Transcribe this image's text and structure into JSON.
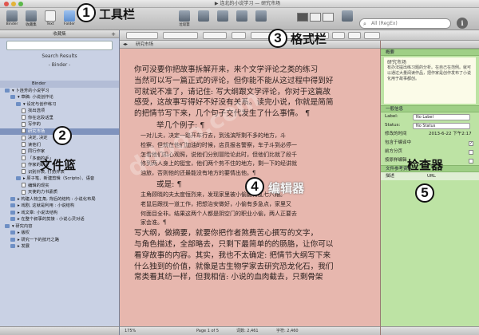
{
  "window": {
    "title": "▶ 连北的小说学习 — 研究市场"
  },
  "toolbar": {
    "buttons": [
      {
        "id": "binder",
        "label": "Binder"
      },
      {
        "id": "collection",
        "label": "收藏集"
      },
      {
        "id": "text",
        "label": "Text"
      },
      {
        "id": "folder",
        "label": "Folder"
      },
      {
        "id": "trash",
        "label": "垃圾篓"
      }
    ],
    "search_placeholder": "All (RegEx)"
  },
  "binder": {
    "header": "收藏集",
    "search_results": "Search Results",
    "binder_label": "- Binder -",
    "tree": [
      {
        "label": "Binder",
        "kind": "head"
      },
      {
        "label": "▾ 卜连芳的小说学习",
        "kind": "folder",
        "indent": 0
      },
      {
        "label": "▾ 草稿: 小说创作论",
        "kind": "folder",
        "indent": 1
      },
      {
        "label": "▾ 设定与创作练习",
        "kind": "folder",
        "indent": 2
      },
      {
        "label": "找出选项",
        "kind": "doc",
        "indent": 3
      },
      {
        "label": "你在这段话里",
        "kind": "doc",
        "indent": 3
      },
      {
        "label": "写作的",
        "kind": "doc",
        "indent": 3
      },
      {
        "label": "研究市场",
        "kind": "doc",
        "indent": 3,
        "selected": true
      },
      {
        "label": "决定, 决定",
        "kind": "doc",
        "indent": 3
      },
      {
        "label": "读他们",
        "kind": "doc",
        "indent": 3
      },
      {
        "label": "同行作家",
        "kind": "doc",
        "indent": 3
      },
      {
        "label": "「多面的手」",
        "kind": "doc",
        "indent": 3
      },
      {
        "label": "作家的职业",
        "kind": "doc",
        "indent": 3
      },
      {
        "label": "识别外表, 打扮外表",
        "kind": "doc",
        "indent": 3
      },
      {
        "label": "▸ 原子笔、新建剪辑（Scripto）、语音",
        "kind": "folder",
        "indent": 2
      },
      {
        "label": "编辑的现实",
        "kind": "doc",
        "indent": 3
      },
      {
        "label": "天使的力书素质",
        "kind": "doc",
        "indent": 3
      },
      {
        "label": "▸ 构建人物主角, 背后的结构 : 小说化布局",
        "kind": "folder",
        "indent": 1
      },
      {
        "label": "▸ 戏剧, 这就是利用 : 小说结构",
        "kind": "folder",
        "indent": 1
      },
      {
        "label": "▸ 戏文章: 小说法结构",
        "kind": "folder",
        "indent": 1
      },
      {
        "label": "▸ 在整个叙事的剪接 : 小说心灵对话",
        "kind": "folder",
        "indent": 1
      },
      {
        "label": "▾ 研究内容",
        "kind": "folder",
        "indent": 0
      },
      {
        "label": "▸ 版权",
        "kind": "folder",
        "indent": 1
      },
      {
        "label": "▸ 研究一下的技巧之路",
        "kind": "folder",
        "indent": 1
      },
      {
        "label": "▸ 发展",
        "kind": "folder",
        "indent": 1
      }
    ]
  },
  "editor": {
    "doc_title": "研究市场",
    "paragraphs": [
      {
        "kind": "p",
        "text": "你可没要你把故事拆解开来，来个文学评论之类的练习"
      },
      {
        "kind": "p",
        "text": "当然可以写一篇正式的评论，但你能不能从这过程中得到好"
      },
      {
        "kind": "p",
        "text": "可就说不准了，请记住: 写大纲跟文学评论，你对于这篇故"
      },
      {
        "kind": "p",
        "text": "感受，这故事写得好不好没有关系。读完小说，你就是简简"
      },
      {
        "kind": "p",
        "text": "的把情节写下来，几个句子交代发生了什么事情。 ¶"
      },
      {
        "kind": "h",
        "text": "举几个例子: ¶"
      },
      {
        "kind": "pi",
        "text": "一对儿夫，决定一路开车行去，到浅滨所剩不多的地方，斗"
      },
      {
        "kind": "pi",
        "text": "检察。但就在他们加油的时候，店员报名警察，车子斗到必停一"
      },
      {
        "kind": "pi",
        "text": "怎看他们扣心观照，说他们分别冒险论此时，但他们比就了段千"
      },
      {
        "kind": "pi",
        "text": "修到两人身上的挺宝，他们两个剪不住的地方，剩一下的经讲就"
      },
      {
        "kind": "pi",
        "text": "油旅，否则他的还最能没有地方的要情出他。¶"
      },
      {
        "kind": "h",
        "text": "或是: ¶"
      },
      {
        "kind": "pi",
        "text": "主角顾晓的夫太度恒烈来，发现家里被小偷翻得乱七八糟。"
      },
      {
        "kind": "pi",
        "text": "老鼠后跟找一道工作，把想治安做好，小偷有多急点，家里又"
      },
      {
        "kind": "pi",
        "text": "何面目全非。结果这两个人都是阴空门的职业小偷，两人正要去"
      },
      {
        "kind": "pi",
        "text": "家会准。¶"
      },
      {
        "kind": "p",
        "text": "写大纲，做摘要，就要你把作者煞费苦心撰写的文字，"
      },
      {
        "kind": "p",
        "text": "与角色描述，全部略去，只剩下最简单的的肠胳，让你可以"
      },
      {
        "kind": "p",
        "text": "看穿故事的内容。其实，我也不太确定: 把情节大纲写下来"
      },
      {
        "kind": "p",
        "text": "什么独到的价值，就像是古生物学家去研究恐龙化石，我们"
      },
      {
        "kind": "p",
        "text": "常类看其纺一样，但我相信: 小说的血肉截去，只剩骨架"
      }
    ],
    "footer": {
      "zoom": "175%",
      "page": "Page 1 of 5",
      "words": "词数: 2,461",
      "chars": "字符: 2,460"
    }
  },
  "inspector": {
    "synopsis_title": "概要",
    "synopsis_heading": "研究市场",
    "synopsis_text": "有办法提出练习题的分析。在自己在范例。就可以通过大量阅读作品，把作家是创作发布了小说化用于故事都创。",
    "general_title": "一般信息",
    "label_key": "Label:",
    "label_val": "No Label",
    "status_key": "Status:",
    "status_val": "No Status",
    "modified_key": "修改的时间",
    "modified_val": "2013-6-22 下午2:17",
    "compile_include": "包含于编译中",
    "page_break_before": "前方分页",
    "compile_as_is": "按原样编辑",
    "doc_refs_title": "文件参考资料",
    "refs_header": "描述",
    "refs_col_url": "URL"
  },
  "callouts": [
    {
      "num": "1",
      "text": "工具栏"
    },
    {
      "num": "2",
      "text": "文件篮"
    },
    {
      "num": "3",
      "text": "格式栏"
    },
    {
      "num": "4",
      "text": "编辑器"
    },
    {
      "num": "5",
      "text": "检查器"
    }
  ],
  "colors": {
    "binder_bg": "#c9d1e4",
    "editor_bg": "#e7b7ae",
    "inspector_bg": "#bde3a4",
    "selection": "#7f93bd"
  }
}
